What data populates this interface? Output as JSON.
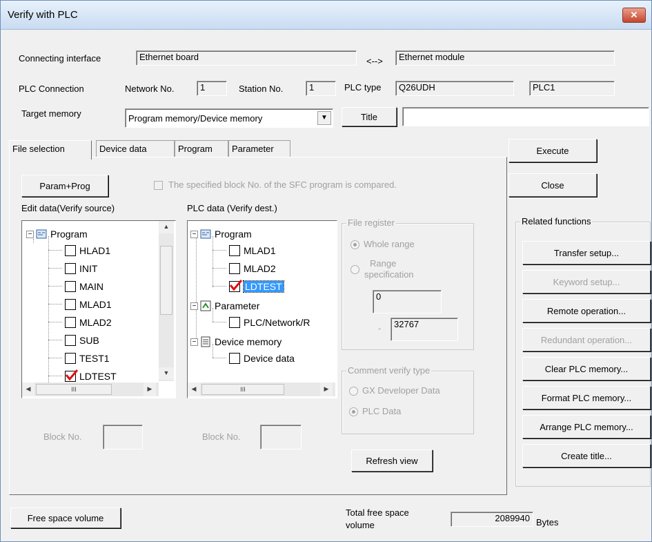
{
  "window": {
    "title": "Verify with PLC",
    "close_label": "✕"
  },
  "connection": {
    "interface_label": "Connecting interface",
    "interface_value": "Ethernet board",
    "arrow": "<-->",
    "module_value": "Ethernet module",
    "plc_connection_label": "PLC Connection",
    "network_label": "Network No.",
    "network_value": "1",
    "station_label": "Station No.",
    "station_value": "1",
    "plc_type_label": "PLC type",
    "plc_type_value": "Q26UDH",
    "plc_name_value": "PLC1",
    "target_memory_label": "Target memory",
    "target_memory_value": "Program memory/Device memory",
    "title_button": "Title",
    "title_value": ""
  },
  "tabs": [
    "File selection",
    "Device data",
    "Program",
    "Parameter"
  ],
  "file_selection": {
    "param_prog_button": "Param+Prog",
    "sfc_checkbox_label": "The specified block No. of the SFC program is compared.",
    "edit_data_label": "Edit data(Verify source)",
    "plc_data_label": "PLC data (Verify dest.)",
    "edit_tree": {
      "root": "Program",
      "items": [
        "HLAD1",
        "INIT",
        "MAIN",
        "MLAD1",
        "MLAD2",
        "SUB",
        "TEST1",
        "LDTEST"
      ]
    },
    "plc_tree": {
      "program": "Program",
      "program_items": [
        "MLAD1",
        "MLAD2",
        "LDTEST"
      ],
      "parameter": "Parameter",
      "parameter_items": [
        "PLC/Network/R"
      ],
      "device_memory": "Device memory",
      "device_items": [
        "Device data"
      ]
    },
    "scroll_thumb_glyph": "III",
    "block_no_label": "Block No.",
    "block_no_value_left": "",
    "block_no_value_right": "",
    "file_register": {
      "title": "File register",
      "whole_range": "Whole range",
      "range_specification_line1": "Range",
      "range_specification_line2": "specification",
      "range_from": "0",
      "dash": "-",
      "range_to": "32767"
    },
    "comment_verify": {
      "title": "Comment verify type",
      "gx_developer": "GX Developer Data",
      "plc_data": "PLC Data"
    },
    "refresh_button": "Refresh view"
  },
  "side": {
    "execute": "Execute",
    "close": "Close",
    "related_title": "Related functions",
    "buttons": [
      "Transfer setup...",
      "Keyword setup...",
      "Remote operation...",
      "Redundant operation...",
      "Clear PLC memory...",
      "Format PLC memory...",
      "Arrange PLC memory...",
      "Create title..."
    ]
  },
  "footer": {
    "free_space_button": "Free space volume",
    "total_label_line1": "Total free space",
    "total_label_line2": "volume",
    "total_value": "2089940",
    "unit": "Bytes"
  }
}
